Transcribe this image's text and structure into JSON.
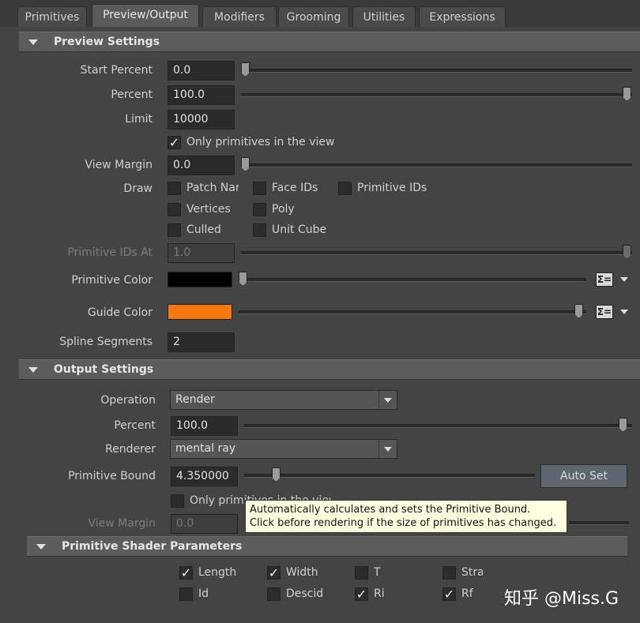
{
  "tabs": [
    "Primitives",
    "Preview/Output",
    "Modifiers",
    "Grooming",
    "Utilities",
    "Expressions"
  ],
  "active_tab": "Preview/Output",
  "preview": {
    "title": "Preview Settings",
    "start_percent": {
      "label": "Start Percent",
      "value": "0.0",
      "slider_fraction": 0.0
    },
    "percent": {
      "label": "Percent",
      "value": "100.0",
      "slider_fraction": 1.0
    },
    "limit": {
      "label": "Limit",
      "value": "10000"
    },
    "only_primitives": {
      "label": "Only primitives in the view",
      "checked": true
    },
    "view_margin": {
      "label": "View Margin",
      "value": "0.0",
      "slider_fraction": 0.0
    },
    "draw": {
      "label": "Draw",
      "options": [
        {
          "label": "Patch Nar",
          "checked": false
        },
        {
          "label": "Face IDs",
          "checked": false
        },
        {
          "label": "Primitive IDs",
          "checked": false
        },
        {
          "label": "Vertices",
          "checked": false
        },
        {
          "label": "Poly",
          "checked": false
        },
        {
          "label": "Culled",
          "checked": false
        },
        {
          "label": "Unit Cube",
          "checked": false
        }
      ]
    },
    "primitive_ids_at": {
      "label": "Primitive IDs At",
      "value": "1.0",
      "enabled": false
    },
    "primitive_color": {
      "label": "Primitive Color",
      "color": "#000000",
      "slider_fraction": 0.0
    },
    "guide_color": {
      "label": "Guide Color",
      "color": "#f7780f",
      "slider_fraction": 1.0
    },
    "spline_segments": {
      "label": "Spline Segments",
      "value": "2"
    }
  },
  "output": {
    "title": "Output Settings",
    "operation": {
      "label": "Operation",
      "value": "Render"
    },
    "percent": {
      "label": "Percent",
      "value": "100.0",
      "slider_fraction": 1.0
    },
    "renderer": {
      "label": "Renderer",
      "value": "mental ray"
    },
    "primitive_bound": {
      "label": "Primitive Bound",
      "value": "4.350000",
      "slider_fraction": 0.1
    },
    "auto_set_label": "Auto Set",
    "only_primitives": {
      "label": "Only primitives in the view",
      "checked": false
    },
    "view_margin": {
      "label": "View Margin",
      "value": "0.0",
      "enabled": false
    }
  },
  "tooltip": {
    "line1": "Automatically calculates and sets the Primitive Bound.",
    "line2": "Click before rendering if the size of primitives has changed."
  },
  "shader": {
    "title": "Primitive Shader Parameters",
    "options": [
      {
        "label": "Length",
        "checked": true
      },
      {
        "label": "Width",
        "checked": true
      },
      {
        "label": "T",
        "checked": false
      },
      {
        "label": "Stra",
        "checked": false
      },
      {
        "label": "Id",
        "checked": false
      },
      {
        "label": "Descid",
        "checked": false
      },
      {
        "label": "Ri",
        "checked": true
      },
      {
        "label": "Rf",
        "checked": true
      }
    ]
  },
  "watermark": "知乎 @Miss.G",
  "icons": {
    "expression_button": "sigma-equals-icon",
    "dropdown": "triangle-down-icon",
    "check": "check-icon"
  }
}
